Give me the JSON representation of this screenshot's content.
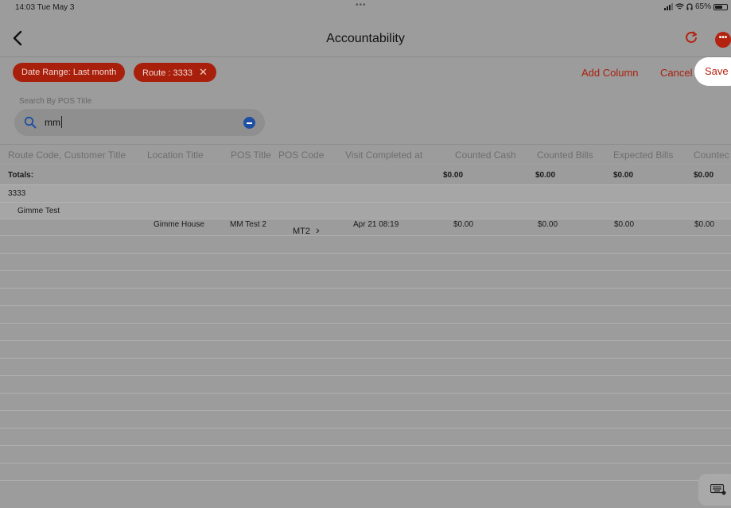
{
  "status_bar": {
    "time": "14:03  Tue May 3",
    "dots": "•••",
    "battery": "65%",
    "battery_level": 0.65
  },
  "nav": {
    "title": "Accountability"
  },
  "filters": {
    "chips": [
      {
        "label": "Date Range: Last month"
      },
      {
        "label": "Route : 3333",
        "remove": "✕"
      }
    ],
    "add_column": "Add Column",
    "cancel": "Cancel",
    "save": "Save"
  },
  "search": {
    "label": "Search By POS Title",
    "value": "mm"
  },
  "table": {
    "columns": [
      "Route Code, Customer Title",
      "Location Title",
      "POS Title",
      "POS Code",
      "Visit Completed at",
      "Counted Cash",
      "Counted Bills",
      "Expected Bills",
      "Countec"
    ],
    "totals": {
      "label": "Totals:",
      "counted_cash": "$0.00",
      "counted_bills": "$0.00",
      "expected_bills": "$0.00",
      "counted": "$0.00"
    },
    "groups": {
      "route": "3333",
      "customer": "Gimme Test"
    },
    "rows": [
      {
        "location": "Gimme House",
        "pos_title": "MM Test 2",
        "pos_code": "MT2",
        "pos_code_chevron": "›",
        "visit_completed": "Apr 21 08:19",
        "counted_cash": "$0.00",
        "counted_bills": "$0.00",
        "expected_bills": "$0.00",
        "counted": "$0.00"
      }
    ]
  },
  "icons": {
    "back": "chevron-left-icon",
    "refresh": "refresh-icon",
    "more": "ellipsis-icon",
    "search": "search-icon",
    "clear": "minus-circle-icon",
    "keyboard": "keyboard-icon"
  },
  "colors": {
    "accent": "#a8200c",
    "background": "#9c9c9c",
    "clear_button": "#1f4fa3"
  }
}
